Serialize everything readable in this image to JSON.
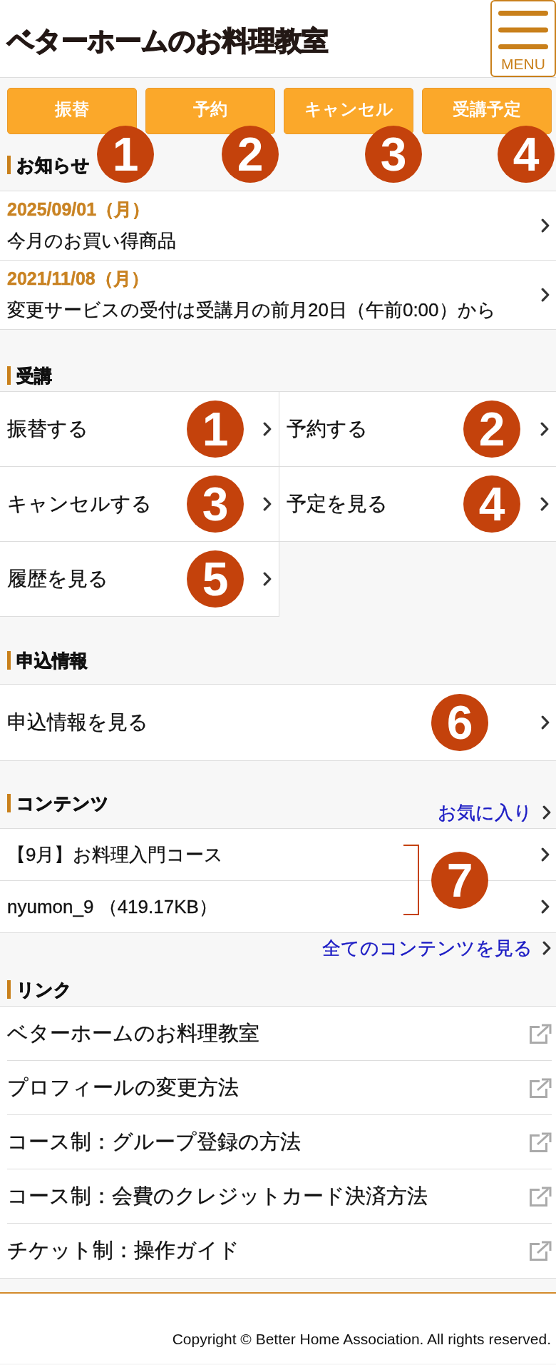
{
  "header": {
    "logo": "ベターホームのお料理教室",
    "menu_button": {
      "label": "MENU"
    }
  },
  "quick_buttons": [
    {
      "label": "振替",
      "badge": "1"
    },
    {
      "label": "予約",
      "badge": "2"
    },
    {
      "label": "キャンセル",
      "badge": "3"
    },
    {
      "label": "受講予定",
      "badge": "4"
    }
  ],
  "notices": {
    "title": "お知らせ",
    "items": [
      {
        "date": "2025/09/01（月）",
        "text": "今月のお買い得商品"
      },
      {
        "date": "2021/11/08（月）",
        "text": "変更サービスの受付は受講月の前月20日（午前0:00）から"
      }
    ]
  },
  "lessons": {
    "title": "受講",
    "items": [
      {
        "label": "振替する",
        "badge": "1"
      },
      {
        "label": "予約する",
        "badge": "2"
      },
      {
        "label": "キャンセルする",
        "badge": "3"
      },
      {
        "label": "予定を見る",
        "badge": "4"
      },
      {
        "label": "履歴を見る",
        "badge": "5"
      }
    ]
  },
  "application": {
    "title": "申込情報",
    "items": [
      {
        "label": "申込情報を見る",
        "badge": "6"
      }
    ]
  },
  "contents": {
    "title": "コンテンツ",
    "favorites_link": "お気に入り",
    "items": [
      {
        "label": "【9月】お料理入門コース"
      },
      {
        "label": "nyumon_9 （419.17KB）"
      }
    ],
    "badge": "7",
    "all_link": "全てのコンテンツを見る"
  },
  "links": {
    "title": "リンク",
    "items": [
      {
        "label": "ベターホームのお料理教室"
      },
      {
        "label": "プロフィールの変更方法"
      },
      {
        "label": "コース制：グループ登録の方法"
      },
      {
        "label": "コース制：会費のクレジットカード決済方法"
      },
      {
        "label": "チケット制：操作ガイド"
      }
    ]
  },
  "footer": {
    "copyright": "Copyright © Better Home Association. All rights reserved."
  }
}
